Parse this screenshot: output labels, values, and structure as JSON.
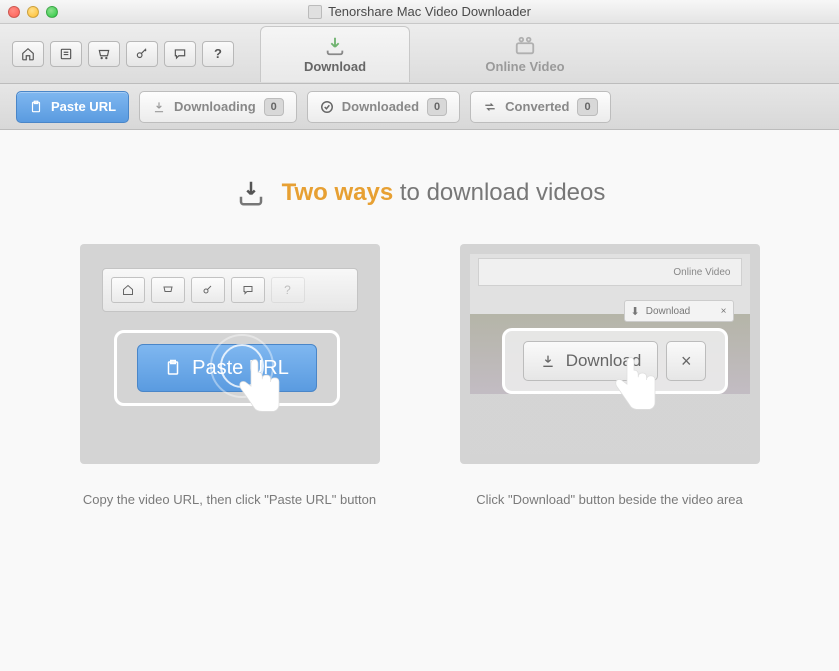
{
  "window": {
    "title": "Tenorshare Mac Video Downloader"
  },
  "tabs": {
    "download": "Download",
    "online_video": "Online Video"
  },
  "subtabs": {
    "paste_url": "Paste URL",
    "downloading": {
      "label": "Downloading",
      "count": "0"
    },
    "downloaded": {
      "label": "Downloaded",
      "count": "0"
    },
    "converted": {
      "label": "Converted",
      "count": "0"
    }
  },
  "headline": {
    "accent": "Two ways",
    "rest": "to download videos"
  },
  "card1": {
    "button_label": "Paste URL",
    "caption": "Copy the video URL, then click \"Paste URL\" button"
  },
  "card2": {
    "top_label": "Online Video",
    "mini_download": "Download",
    "button_label": "Download",
    "close": "×",
    "caption": "Click \"Download\" button beside the video area"
  }
}
